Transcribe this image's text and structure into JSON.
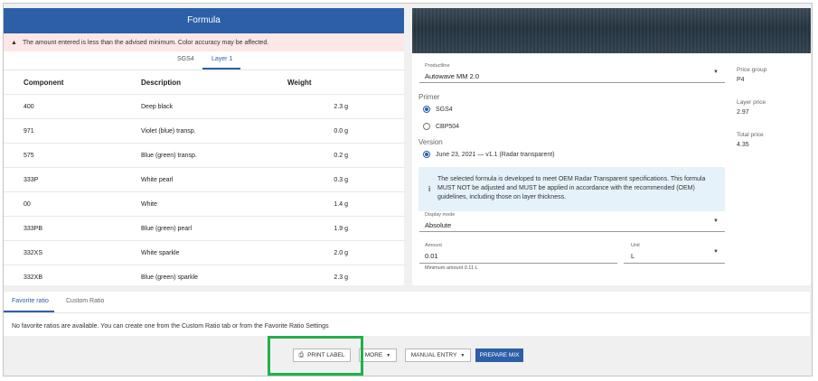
{
  "formula_header": "Formula",
  "warning": "The amount entered is less than the advised minimum. Color accuracy may be affected.",
  "layer_tabs": [
    {
      "label": "SGS4",
      "active": false
    },
    {
      "label": "Layer 1",
      "active": true
    }
  ],
  "table": {
    "headers": [
      "Component",
      "Description",
      "Weight"
    ],
    "rows": [
      {
        "component": "400",
        "description": "Deep black",
        "weight": "2.3 g"
      },
      {
        "component": "971",
        "description": "Violet (blue) transp.",
        "weight": "0.0 g"
      },
      {
        "component": "575",
        "description": "Blue (green) transp.",
        "weight": "0.2 g"
      },
      {
        "component": "333P",
        "description": "White pearl",
        "weight": "0.3 g"
      },
      {
        "component": "00",
        "description": "White",
        "weight": "1.4 g"
      },
      {
        "component": "333PB",
        "description": "Blue (green) pearl",
        "weight": "1.9 g"
      },
      {
        "component": "332XS",
        "description": "White sparkle",
        "weight": "2.0 g"
      },
      {
        "component": "332XB",
        "description": "Blue (green) sparkle",
        "weight": "2.3 g"
      }
    ]
  },
  "productline": {
    "label": "Productline",
    "value": "Autowave MM 2.0"
  },
  "primer": {
    "label": "Primer",
    "options": [
      {
        "label": "SGS4",
        "checked": true
      },
      {
        "label": "CBP504",
        "checked": false
      }
    ]
  },
  "version": {
    "label": "Version",
    "value": "June 23, 2021 — v1.1 (Radar transparent)",
    "checked": true
  },
  "info": "The selected formula is developed to meet OEM Radar Transparent specifications. This formula MUST NOT be adjusted and MUST be applied in accordance with the recommended (OEM) guidelines, including those on layer thickness.",
  "display_mode": {
    "label": "Display mode",
    "value": "Absolute"
  },
  "amount": {
    "label": "Amount",
    "value": "0.01",
    "hint": "Minimum amount 0.11 L"
  },
  "unit": {
    "label": "Unit",
    "value": "L"
  },
  "prices": {
    "price_group_label": "Price group",
    "price_group_value": "P4",
    "layer_price_label": "Layer price",
    "layer_price_value": "2.97",
    "total_price_label": "Total price",
    "total_price_value": "4.35"
  },
  "bottom_tabs": [
    {
      "label": "Favorite ratio",
      "active": true
    },
    {
      "label": "Custom Ratio",
      "active": false
    }
  ],
  "bottom_message": "No favorite ratios are available. You can create one from the Custom Ratio tab or from the Favorite Ratio Settings",
  "buttons": {
    "print_label": "PRINT LABEL",
    "more": "MORE",
    "manual_entry": "MANUAL ENTRY",
    "prepare_mix": "PREPARE MIX"
  },
  "icons": {
    "warning": "warning-icon",
    "info": "info-icon",
    "printer": "printer-icon",
    "chevron": "chevron-down-icon"
  },
  "colors": {
    "primary": "#2c5fa8",
    "warning_bg": "#fde7e7",
    "info_bg": "#e6f2fa",
    "highlight": "#22b04b"
  }
}
